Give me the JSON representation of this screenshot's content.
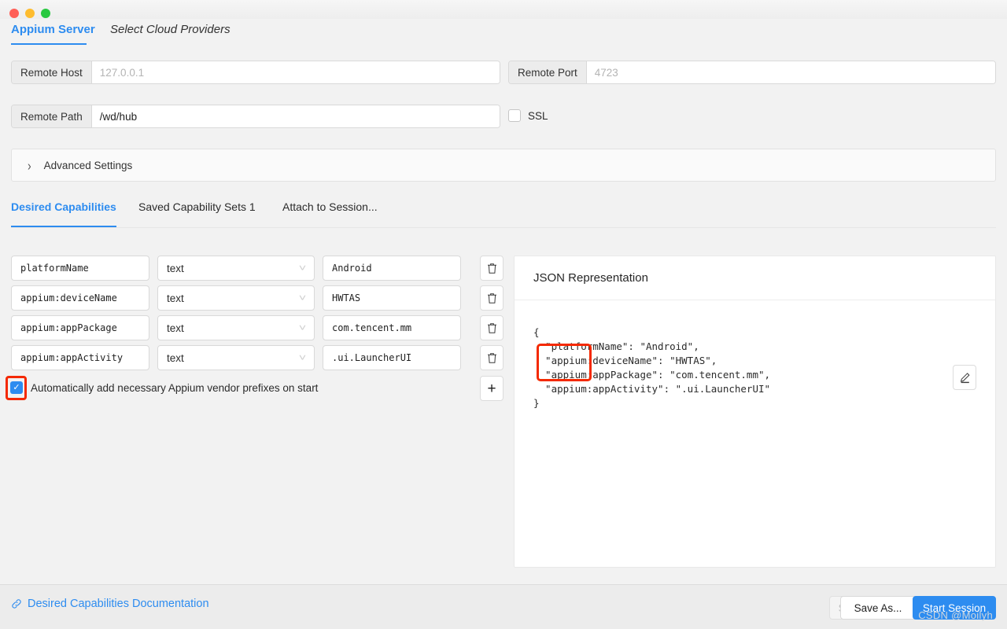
{
  "window": {
    "traffic_lights": [
      "close",
      "minimize",
      "maximize"
    ],
    "accent_color": "#2d8cf0",
    "highlight_color": "#f42900"
  },
  "top_tabs": [
    {
      "label": "Appium Server",
      "active": true
    },
    {
      "label": "Select Cloud Providers",
      "active": false
    }
  ],
  "server_config": {
    "remote_host": {
      "label": "Remote Host",
      "value": "",
      "placeholder": "127.0.0.1"
    },
    "remote_port": {
      "label": "Remote Port",
      "value": "",
      "placeholder": "4723"
    },
    "remote_path": {
      "label": "Remote Path",
      "value": "/wd/hub",
      "placeholder": "/wd/hub"
    },
    "ssl": {
      "label": "SSL",
      "checked": false
    },
    "advanced_settings": {
      "label": "Advanced Settings",
      "expanded": false,
      "chevron": "chevron-right-icon"
    }
  },
  "capability_tabs": [
    {
      "label": "Desired Capabilities",
      "active": true
    },
    {
      "label": "Saved Capability Sets 1",
      "active": false
    },
    {
      "label": "Attach to Session...",
      "active": false
    }
  ],
  "capabilities": [
    {
      "name": "platformName",
      "type": "text",
      "value": "Android"
    },
    {
      "name": "appium:deviceName",
      "type": "text",
      "value": "HWTAS"
    },
    {
      "name": "appium:appPackage",
      "type": "text",
      "value": "com.tencent.mm"
    },
    {
      "name": "appium:appActivity",
      "type": "text",
      "value": ".ui.LauncherUI"
    }
  ],
  "row_actions": {
    "delete_icon": "trash-icon",
    "add_icon": "plus-icon"
  },
  "auto_prefix": {
    "label": "Automatically add necessary Appium vendor prefixes on start",
    "checked": true
  },
  "json_panel": {
    "title": "JSON Representation",
    "edit_icon": "pencil-icon",
    "content": "{\n  \"platformName\": \"Android\",\n  \"appium:deviceName\": \"HWTAS\",\n  \"appium:appPackage\": \"com.tencent.mm\",\n  \"appium:appActivity\": \".ui.LauncherUI\"\n}"
  },
  "footer": {
    "documentation_link": "Desired Capabilities Documentation",
    "link_icon": "link-icon",
    "save": {
      "label": "Save",
      "disabled": true
    },
    "save_as": {
      "label": "Save As...",
      "disabled": false
    },
    "start_session": {
      "label": "Start Session",
      "disabled": false
    }
  },
  "watermark": "CSDN @Moilyh"
}
